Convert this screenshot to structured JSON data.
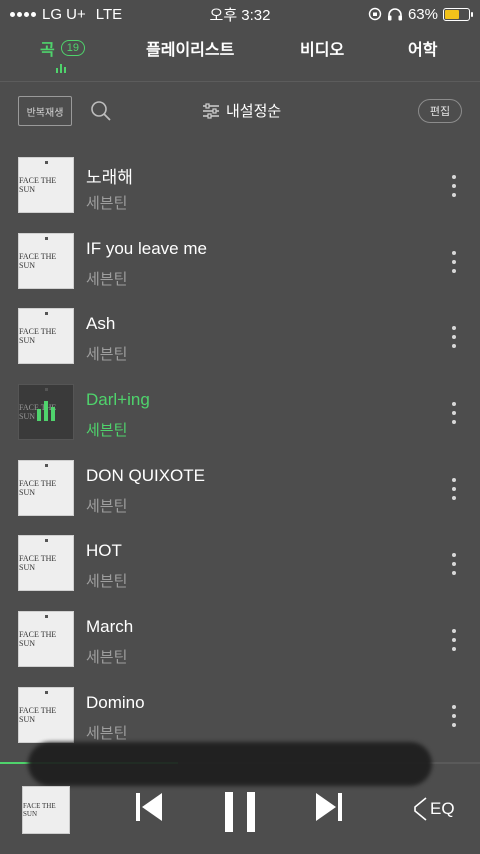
{
  "status_bar": {
    "carrier": "LG U+",
    "network": "LTE",
    "time": "오후 3:32",
    "battery_percent": "63%",
    "battery_level": 0.63
  },
  "tabs": [
    {
      "label": "곡",
      "badge": "19",
      "active": true
    },
    {
      "label": "플레이리스트",
      "active": false
    },
    {
      "label": "비디오",
      "active": false
    },
    {
      "label": "어학",
      "active": false
    }
  ],
  "toolbar": {
    "repeat_label": "반복재생",
    "sort_label": "내설정순",
    "edit_label": "편집"
  },
  "album_art_text": "FACE THE SUN",
  "songs": [
    {
      "title": "노래해",
      "artist": "세븐틴",
      "playing": false
    },
    {
      "title": "IF you leave me",
      "artist": "세븐틴",
      "playing": false
    },
    {
      "title": "Ash",
      "artist": "세븐틴",
      "playing": false
    },
    {
      "title": "Darl+ing",
      "artist": "세븐틴",
      "playing": true
    },
    {
      "title": "DON QUIXOTE",
      "artist": "세븐틴",
      "playing": false
    },
    {
      "title": "HOT",
      "artist": "세븐틴",
      "playing": false
    },
    {
      "title": "March",
      "artist": "세븐틴",
      "playing": false
    },
    {
      "title": "Domino",
      "artist": "세븐틴",
      "playing": false
    }
  ],
  "player": {
    "progress": 0.37,
    "eq_label": "EQ"
  },
  "colors": {
    "accent": "#4fd36c",
    "background": "#4d4d4d",
    "battery": "#f2c21a"
  }
}
